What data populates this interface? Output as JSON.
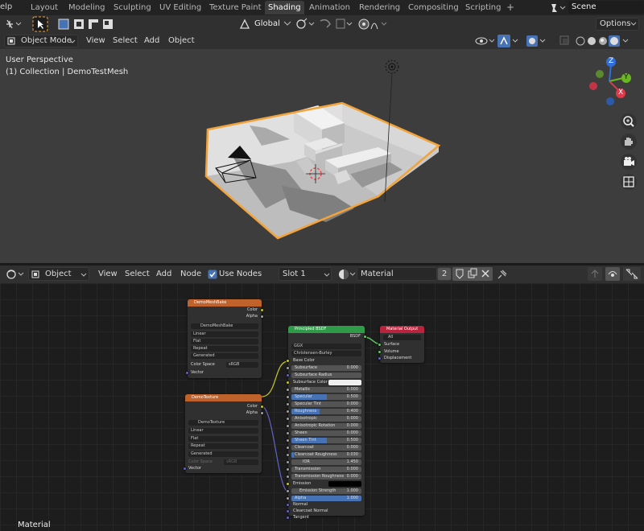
{
  "topbar": {
    "menu_partial": "elp",
    "tabs": [
      {
        "label": "Layout"
      },
      {
        "label": "Modeling"
      },
      {
        "label": "Sculpting"
      },
      {
        "label": "UV Editing"
      },
      {
        "label": "Texture Paint"
      },
      {
        "label": "Shading"
      },
      {
        "label": "Animation"
      },
      {
        "label": "Rendering"
      },
      {
        "label": "Compositing"
      },
      {
        "label": "Scripting"
      }
    ],
    "add_tab": "+",
    "scene": "Scene"
  },
  "viewport_header": {
    "transform_orientation": "Global",
    "options_label": "Options"
  },
  "viewport_header2": {
    "mode": "Object Mode",
    "view": "View",
    "select": "Select",
    "add": "Add",
    "object": "Object"
  },
  "viewport": {
    "perspective": "User Perspective",
    "collection": "(1) Collection | DemoTestMesh",
    "gizmo": {
      "z": "Z",
      "y": "Y",
      "x": "X"
    }
  },
  "node_header": {
    "editor_type": "Object",
    "view": "View",
    "select": "Select",
    "add": "Add",
    "node": "Node",
    "use_nodes_label": "Use Nodes",
    "use_nodes_checked": true,
    "slot": "Slot 1",
    "material": "Material",
    "users": "2"
  },
  "nodes": {
    "bake": {
      "title": "DemoMeshBake",
      "out_color": "Color",
      "out_alpha": "Alpha",
      "image": "DemoMeshBake",
      "interpolation": "Linear",
      "projection": "Flat",
      "extension": "Repeat",
      "source": "Generated",
      "color_space_label": "Color Space",
      "color_space": "sRGB",
      "in_vector": "Vector",
      "color": "#c0622b"
    },
    "texture": {
      "title": "DemoTexture",
      "out_color": "Color",
      "out_alpha": "Alpha",
      "image": "DemoTexture",
      "interpolation": "Linear",
      "projection": "Flat",
      "extension": "Repeat",
      "source": "Generated",
      "color_space_label": "Color Space",
      "color_space": "sRGB",
      "in_vector": "Vector",
      "color": "#c0622b"
    },
    "bsdf": {
      "title": "Principled BSDF",
      "out_bsdf": "BSDF",
      "distribution": "GGX",
      "subsurface_method": "Christensen-Burley",
      "color": "#2f9b48",
      "base_color": "Base Color",
      "subsurface": {
        "label": "Subsurface",
        "value": "0.000",
        "fill": 0
      },
      "subsurface_radius": "Subsurface Radius",
      "subsurface_color": "Subsurface Color",
      "metallic": {
        "label": "Metallic",
        "value": "0.000",
        "fill": 0
      },
      "specular": {
        "label": "Specular",
        "value": "0.500",
        "fill": 0.5
      },
      "specular_tint": {
        "label": "Specular Tint",
        "value": "0.000",
        "fill": 0
      },
      "roughness": {
        "label": "Roughness",
        "value": "0.400",
        "fill": 0.4
      },
      "anisotropic": {
        "label": "Anisotropic",
        "value": "0.000",
        "fill": 0
      },
      "anisotropic_rotation": {
        "label": "Anisotropic Rotation",
        "value": "0.000",
        "fill": 0
      },
      "sheen": {
        "label": "Sheen",
        "value": "0.000",
        "fill": 0
      },
      "sheen_tint": {
        "label": "Sheen Tint",
        "value": "0.500",
        "fill": 0.5
      },
      "clearcoat": {
        "label": "Clearcoat",
        "value": "0.000",
        "fill": 0
      },
      "clearcoat_roughness": {
        "label": "Clearcoat Roughness",
        "value": "0.030",
        "fill": 0.03
      },
      "ior": {
        "label": "IOR",
        "value": "1.450",
        "fill": 0
      },
      "transmission": {
        "label": "Transmission",
        "value": "0.000",
        "fill": 0
      },
      "transmission_roughness": {
        "label": "Transmission Roughness",
        "value": "0.000",
        "fill": 0
      },
      "emission": "Emission",
      "emission_strength": {
        "label": "Emission Strength",
        "value": "1.000",
        "fill": 0
      },
      "alpha": {
        "label": "Alpha",
        "value": "1.000",
        "fill": 1
      },
      "normal": "Normal",
      "clearcoat_normal": "Clearcoat Normal",
      "tangent": "Tangent"
    },
    "output": {
      "title": "Material Output",
      "target": "All",
      "surface": "Surface",
      "volume": "Volume",
      "displacement": "Displacement",
      "color": "#b8243d"
    }
  },
  "footer": {
    "material_label": "Material"
  },
  "colors": {
    "accent_blue": "#4772b3",
    "selection_orange": "#f2a33a",
    "socket_yellow": "#c7c729",
    "socket_green": "#63c763",
    "socket_purple": "#6363c7",
    "socket_gray": "#a1a1a1"
  }
}
